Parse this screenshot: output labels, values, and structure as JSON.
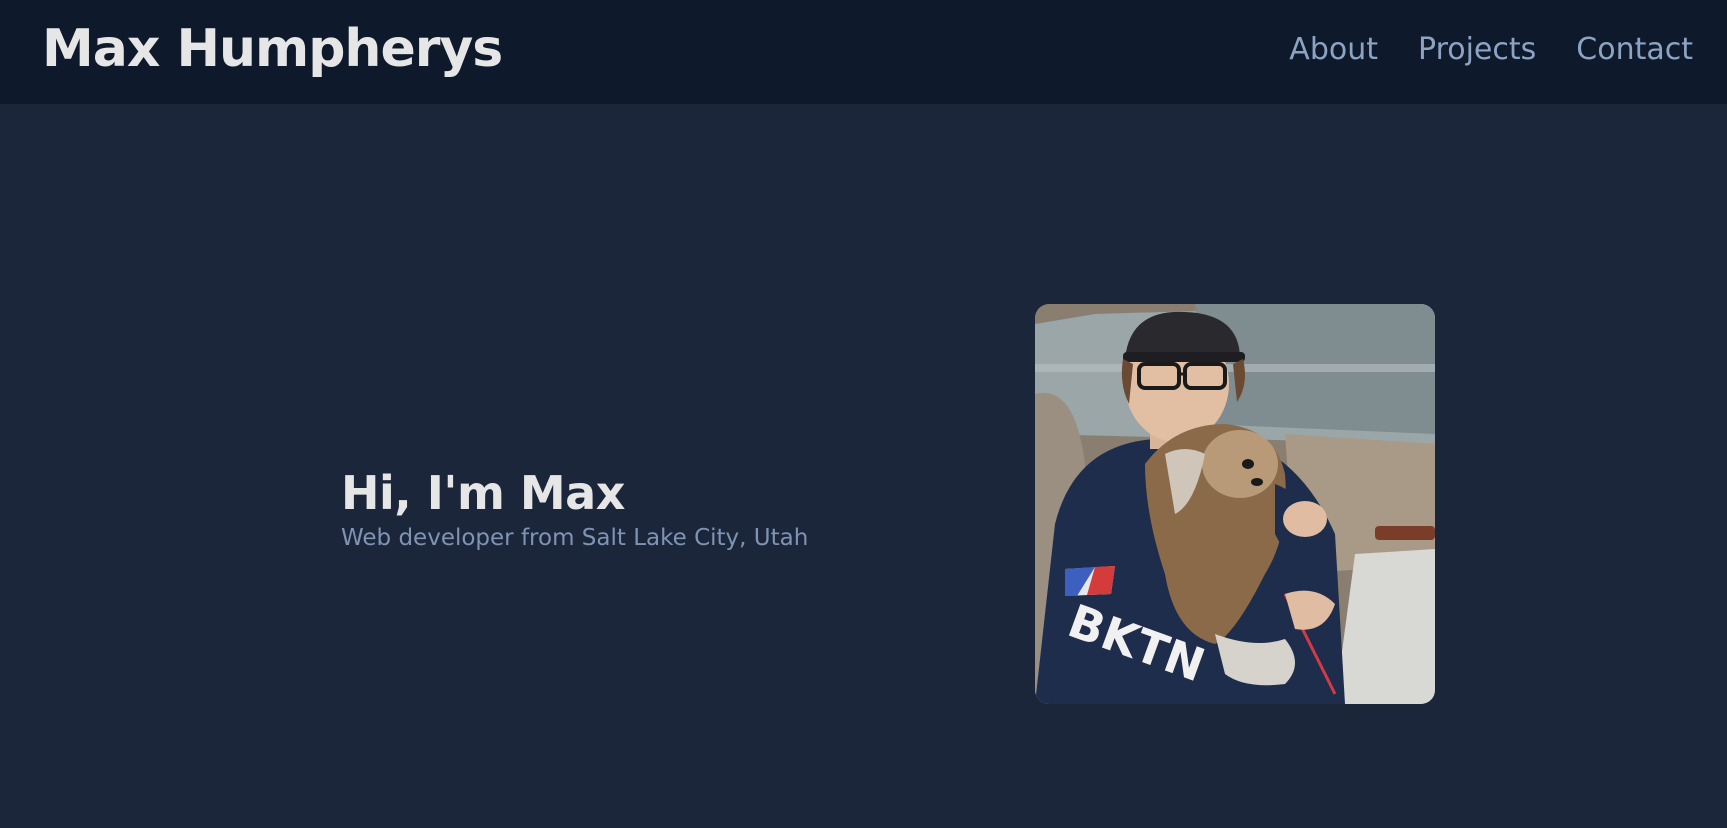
{
  "header": {
    "site_title": "Max Humpherys",
    "nav": [
      {
        "label": "About"
      },
      {
        "label": "Projects"
      },
      {
        "label": "Contact"
      }
    ]
  },
  "hero": {
    "heading": "Hi, I'm Max",
    "subtitle": "Web developer from Salt Lake City, Utah",
    "photo": {
      "description_icon": "profile-photo",
      "shirt_text": "BKTN"
    }
  },
  "colors": {
    "background": "#1b263b",
    "navbar": "#0e1a2b",
    "title_text": "#e6e6e6",
    "nav_text": "#8ca3c3",
    "subtitle_text": "#7f93b3"
  }
}
